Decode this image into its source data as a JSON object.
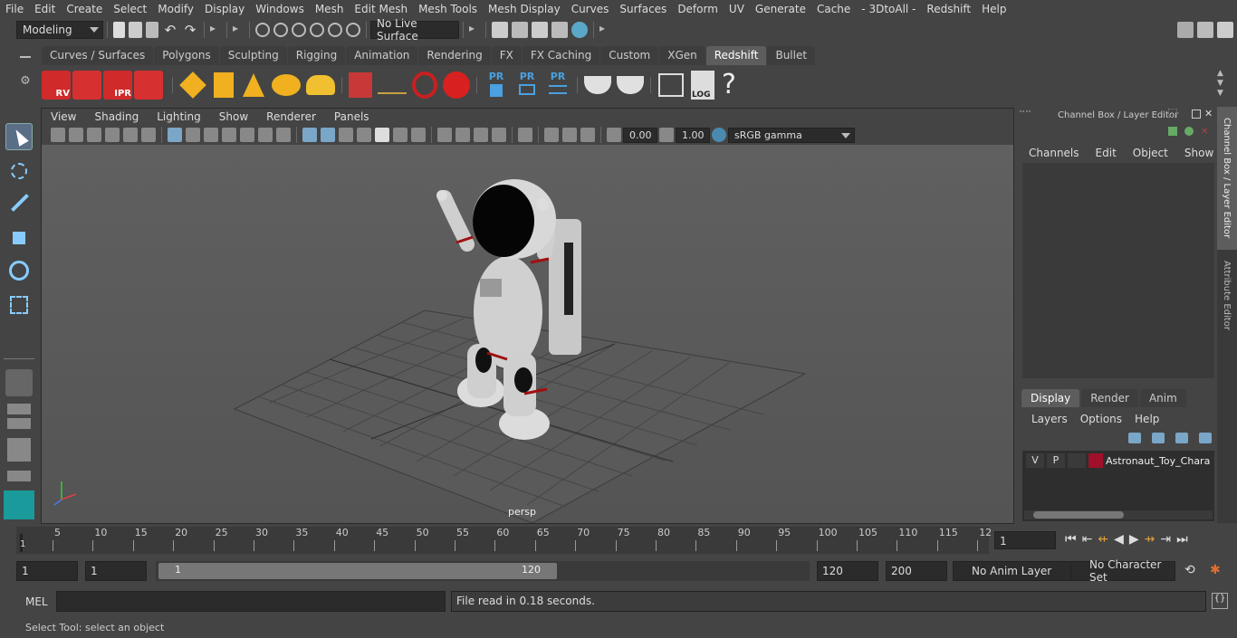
{
  "menubar": {
    "items": [
      "File",
      "Edit",
      "Create",
      "Select",
      "Modify",
      "Display",
      "Windows",
      "Mesh",
      "Edit Mesh",
      "Mesh Tools",
      "Mesh Display",
      "Curves",
      "Surfaces",
      "Deform",
      "UV",
      "Generate",
      "Cache",
      "- 3DtoAll -",
      "Redshift",
      "Help"
    ]
  },
  "status": {
    "mode": "Modeling",
    "live_surface": "No Live Surface"
  },
  "shelf": {
    "tabs": [
      "Curves / Surfaces",
      "Polygons",
      "Sculpting",
      "Rigging",
      "Animation",
      "Rendering",
      "FX",
      "FX Caching",
      "Custom",
      "XGen",
      "Redshift",
      "Bullet"
    ],
    "active": "Redshift",
    "icon_labels": {
      "rv": "RV",
      "ipr": "IPR",
      "pr": "PR",
      "log": "LOG",
      "help": "?"
    }
  },
  "viewport": {
    "menu": [
      "View",
      "Shading",
      "Lighting",
      "Show",
      "Renderer",
      "Panels"
    ],
    "exposure": "0.00",
    "gamma": "1.00",
    "colorspace": "sRGB gamma",
    "camera": "persp"
  },
  "channelbox": {
    "title": "Channel Box / Layer Editor",
    "menu": [
      "Channels",
      "Edit",
      "Object",
      "Show"
    ]
  },
  "layers": {
    "tabs": [
      "Display",
      "Render",
      "Anim"
    ],
    "active": "Display",
    "menu": [
      "Layers",
      "Options",
      "Help"
    ],
    "row": {
      "v": "V",
      "p": "P",
      "name": "Astronaut_Toy_Charac",
      "color": "#a0102a"
    }
  },
  "side_tabs": [
    "Channel Box / Layer Editor",
    "Attribute Editor"
  ],
  "timeline": {
    "ticks": [
      "5",
      "10",
      "15",
      "20",
      "25",
      "30",
      "35",
      "40",
      "45",
      "50",
      "55",
      "60",
      "65",
      "70",
      "75",
      "80",
      "85",
      "90",
      "95",
      "100",
      "105",
      "110",
      "115",
      "12"
    ],
    "start_label": "1",
    "current_frame": "1"
  },
  "range": {
    "start": "1",
    "anim_start": "1",
    "slider_start": "1",
    "slider_end": "120",
    "end": "120",
    "anim_end": "200",
    "anim_layer": "No Anim Layer",
    "character_set": "No Character Set"
  },
  "command": {
    "lang": "MEL",
    "result": "File read in  0.18 seconds."
  },
  "help_line": "Select Tool: select an object"
}
